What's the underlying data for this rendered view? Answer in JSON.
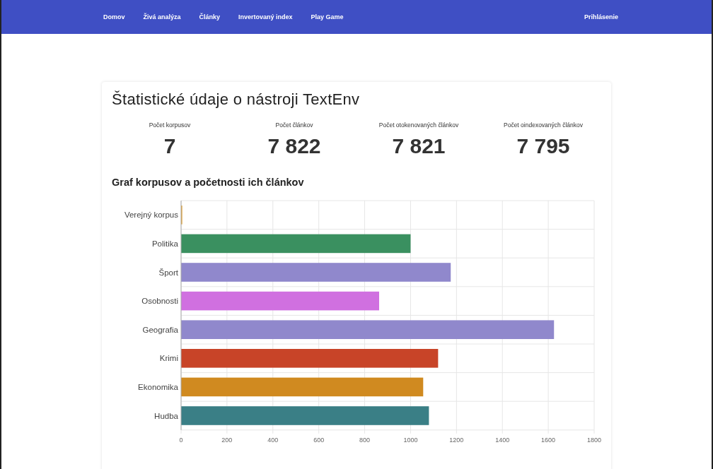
{
  "nav": {
    "links": [
      {
        "label": "Domov"
      },
      {
        "label": "Živá analýza"
      },
      {
        "label": "Články"
      },
      {
        "label": "Invertovaný index"
      },
      {
        "label": "Play Game"
      }
    ],
    "login": "Prihlásenie"
  },
  "title": "Štatistické údaje o nástroji TextEnv",
  "stats": [
    {
      "label": "Počet korpusov",
      "value": "7"
    },
    {
      "label": "Počet článkov",
      "value": "7 822"
    },
    {
      "label": "Počet otokenovaných článkov",
      "value": "7 821"
    },
    {
      "label": "Počet oindexovaných článkov",
      "value": "7 795"
    }
  ],
  "chart_heading": "Graf korpusov a početnosti ich článkov",
  "chart_data": {
    "type": "bar",
    "orientation": "horizontal",
    "categories": [
      "Verejný korpus",
      "Politika",
      "Šport",
      "Osobnosti",
      "Geografia",
      "Krimi",
      "Ekonomika",
      "Hudba"
    ],
    "colors": [
      "#e0a030",
      "#3a9060",
      "#9088cc",
      "#d070e0",
      "#9088cc",
      "#c84428",
      "#d08a20",
      "#3a7f86"
    ],
    "values": [
      5,
      1000,
      1175,
      863,
      1625,
      1120,
      1055,
      1080
    ],
    "grid": true,
    "xlim": [
      0,
      1800
    ],
    "xticks": [
      0,
      200,
      400,
      600,
      800,
      1000,
      1200,
      1400,
      1600,
      1800
    ]
  }
}
